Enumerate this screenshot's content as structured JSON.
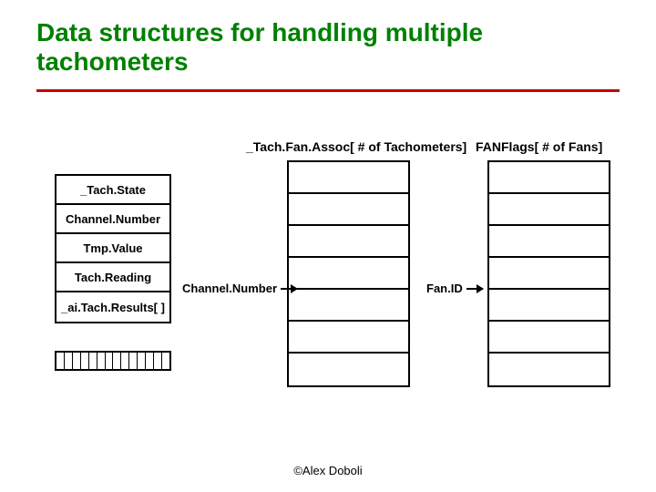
{
  "title": "Data structures for handling multiple tachometers",
  "struct": {
    "fields": [
      "_Tach.State",
      "Channel.Number",
      "Tmp.Value",
      "Tach.Reading",
      "_ai.Tach.Results[ ]"
    ]
  },
  "arrays": {
    "tach": {
      "header": "_Tach.Fan.Assoc[ # of Tachometers]",
      "pointer_label": "Channel.Number",
      "rows": 7
    },
    "fan": {
      "header": "FANFlags[ # of Fans]",
      "pointer_label": "Fan.ID",
      "rows": 7
    }
  },
  "footer": "©Alex Doboli"
}
